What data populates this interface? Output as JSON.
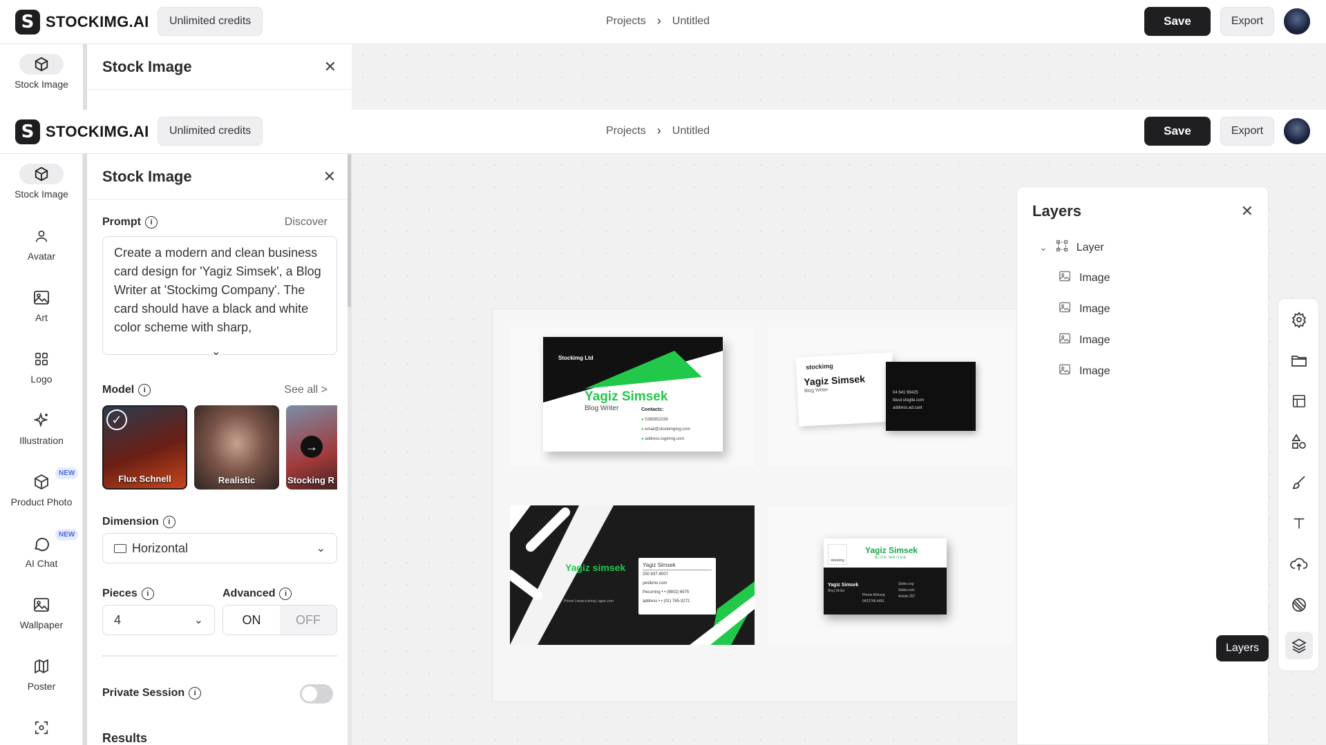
{
  "app": {
    "logo_letter": "S",
    "logo_text": "STOCKIMG.AI",
    "credits": "Unlimited credits"
  },
  "breadcrumb": {
    "projects": "Projects",
    "current": "Untitled"
  },
  "header": {
    "save_label": "Save",
    "export_label": "Export"
  },
  "ghost_panel": {
    "title": "Stock Image",
    "nav_label": "Stock Image"
  },
  "sidebar": {
    "items": [
      {
        "label": "Stock Image",
        "icon": "cube-icon",
        "active": true
      },
      {
        "label": "Avatar",
        "icon": "person-icon"
      },
      {
        "label": "Art",
        "icon": "image-icon"
      },
      {
        "label": "Logo",
        "icon": "grid-icon"
      },
      {
        "label": "Illustration",
        "icon": "sparkle-icon"
      },
      {
        "label": "Product Photo",
        "icon": "box-icon",
        "badge": "NEW"
      },
      {
        "label": "AI Chat",
        "icon": "chat-icon",
        "badge": "NEW"
      },
      {
        "label": "Wallpaper",
        "icon": "image-icon"
      },
      {
        "label": "Poster",
        "icon": "map-icon"
      }
    ]
  },
  "panel": {
    "title": "Stock Image",
    "prompt_label": "Prompt",
    "discover": "Discover",
    "prompt_text": "Create a modern and clean business card design for 'Yagiz Simsek', a Blog Writer at 'Stockimg Company'. The card should have a black and white color scheme with sharp,",
    "model_label": "Model",
    "see_all": "See all >",
    "models": [
      {
        "name": "Flux Schnell",
        "selected": true
      },
      {
        "name": "Realistic"
      },
      {
        "name": "Stocking R"
      }
    ],
    "dimension_label": "Dimension",
    "dimension_value": "Horizontal",
    "pieces_label": "Pieces",
    "pieces_value": "4",
    "advanced_label": "Advanced",
    "advanced_on": "ON",
    "advanced_off": "OFF",
    "private_label": "Private Session",
    "private_enabled": false,
    "results_label": "Results"
  },
  "cards": [
    {
      "company": "Stockimg Ltd",
      "name": "Yagiz Simsek",
      "role": "Blog Writer",
      "contacts_title": "Contacts:",
      "lines": [
        "0265652238",
        "email@stockimgmg.com",
        "address.logimng.com"
      ]
    },
    {
      "company": "stockimg",
      "name": "Yagiz Simsek",
      "role": "Blog Writer",
      "lines": [
        "04 641 99425",
        "tbuul.stogtle.com",
        "address.ad.cant"
      ]
    },
    {
      "name": "Yagiz simsek",
      "panel_name": "Yagiz Simsek",
      "lines": [
        "250 637-9007",
        "yestkmo.com",
        "Pecorring • • (9802) 6575",
        "address • • (01) 765-3272"
      ],
      "footer": "Phone | www.rcoring | agne.com"
    },
    {
      "company": "stockimg",
      "name": "Yagiz Simsek",
      "role": "BLOG WRITER",
      "sub_name": "Yagiz Simsek",
      "sub_role": "Blog Writer",
      "lines": [
        "Stoke.cog",
        "Phone Ekhsng",
        "Stoke.com",
        "0422746.4491",
        "Aclokc.257"
      ]
    }
  ],
  "layers": {
    "title": "Layers",
    "group": "Layer",
    "items": [
      "Image",
      "Image",
      "Image",
      "Image"
    ]
  },
  "tools": {
    "items": [
      "gear-icon",
      "folder-icon",
      "layout-icon",
      "shapes-icon",
      "brush-icon",
      "text-icon",
      "upload-icon",
      "sticker-icon",
      "layers-icon"
    ],
    "tooltip": "Layers"
  },
  "colors": {
    "accent_green": "#22c84a",
    "dark": "#1f1f22",
    "badge_blue": "#4a6bd8"
  }
}
